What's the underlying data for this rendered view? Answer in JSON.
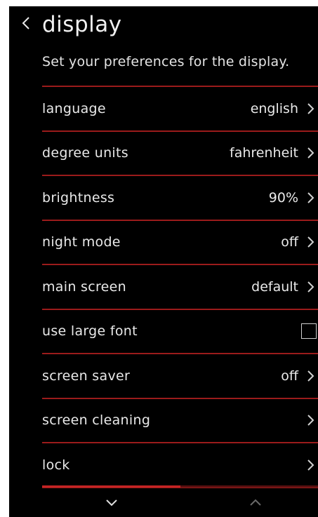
{
  "header": {
    "title": "display",
    "subtitle": "Set your preferences for the display."
  },
  "settings": [
    {
      "label": "language",
      "value": "english",
      "control": "chevron"
    },
    {
      "label": "degree units",
      "value": "fahrenheit",
      "control": "chevron"
    },
    {
      "label": "brightness",
      "value": "90%",
      "control": "chevron"
    },
    {
      "label": "night mode",
      "value": "off",
      "control": "chevron"
    },
    {
      "label": "main screen",
      "value": "default",
      "control": "chevron"
    },
    {
      "label": "use large font",
      "value": "",
      "control": "checkbox",
      "checked": false
    },
    {
      "label": "screen saver",
      "value": "off",
      "control": "chevron"
    },
    {
      "label": "screen cleaning",
      "value": "",
      "control": "chevron"
    },
    {
      "label": "lock",
      "value": "",
      "control": "chevron"
    }
  ],
  "scroll": {
    "position_fraction": 0.5
  },
  "icons": {
    "back": "chevron-left-icon",
    "row": "chevron-right-icon",
    "page_down": "chevron-down-icon",
    "page_up": "chevron-up-icon"
  },
  "colors": {
    "background": "#000000",
    "divider": "#9b1b1b",
    "text": "#e9e9e9",
    "scroll_thumb": "#c42424",
    "disabled_icon": "#6a6a6a"
  }
}
